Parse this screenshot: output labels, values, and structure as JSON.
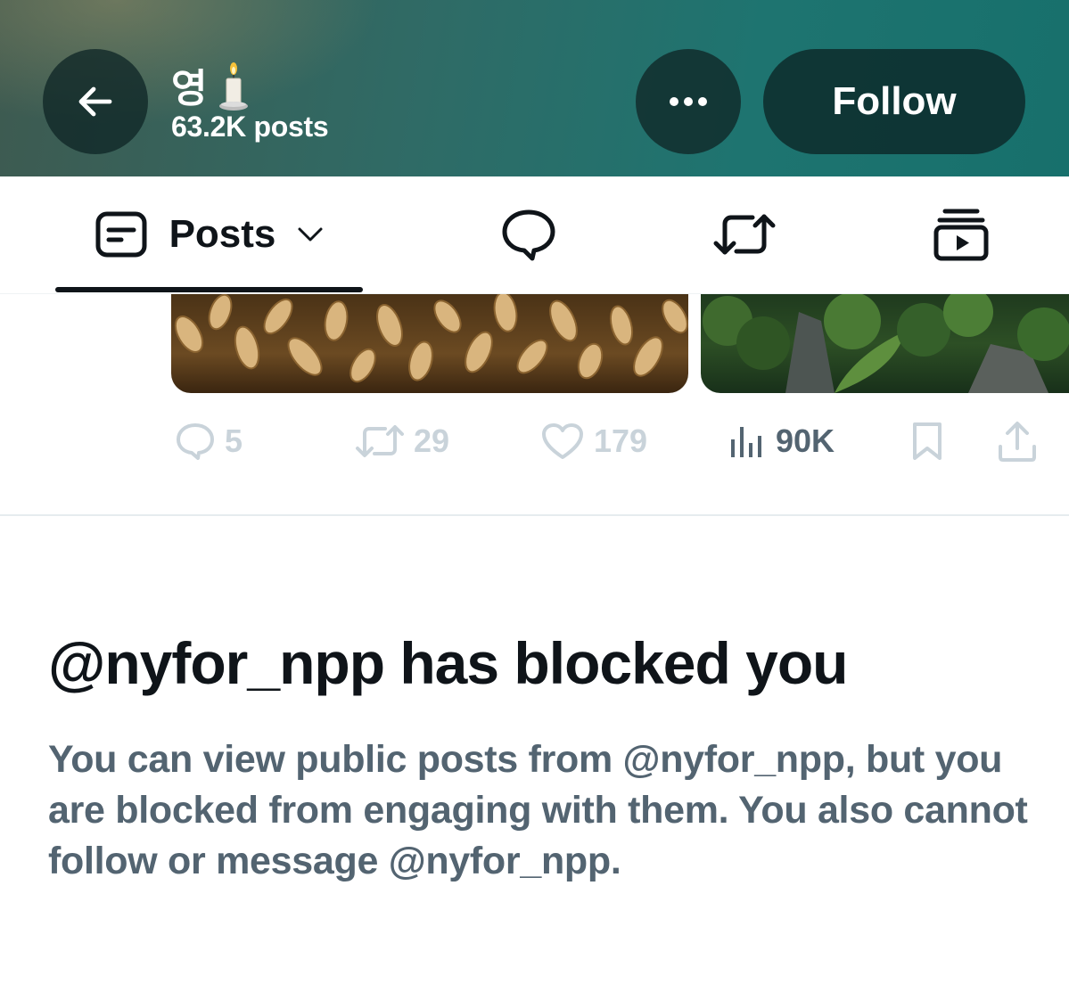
{
  "header": {
    "name": "영",
    "name_emoji": "🕯️",
    "post_count": "63.2K posts",
    "follow_label": "Follow"
  },
  "tabs": {
    "posts_label": "Posts"
  },
  "post_actions": {
    "replies": "5",
    "reposts": "29",
    "likes": "179",
    "views": "90K"
  },
  "blocked": {
    "title": "@nyfor_npp has blocked you",
    "description": "You can view public posts from @nyfor_npp, but you are blocked from engaging with them. You also cannot follow or message @nyfor_npp."
  },
  "colors": {
    "header_teal": "#1e7470",
    "text_primary": "#0f1419",
    "text_secondary": "#536471",
    "icon_dim": "#c9d3da"
  }
}
